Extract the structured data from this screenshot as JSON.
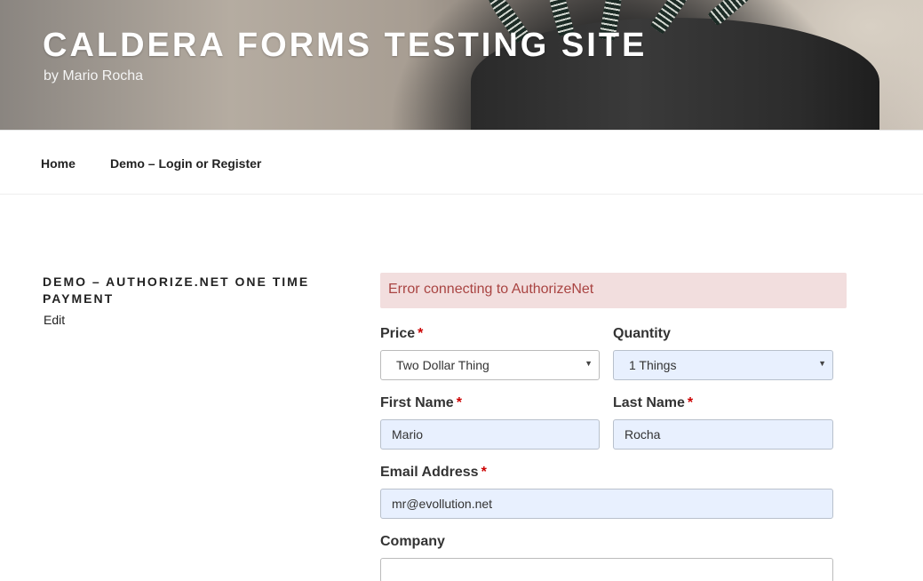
{
  "site": {
    "title": "CALDERA FORMS TESTING SITE",
    "tagline": "by Mario Rocha"
  },
  "nav": {
    "items": [
      {
        "label": "Home"
      },
      {
        "label": "Demo – Login or Register"
      }
    ]
  },
  "page": {
    "title": "DEMO – AUTHORIZE.NET ONE TIME PAYMENT",
    "edit_label": "Edit"
  },
  "form": {
    "error": "Error connecting to AuthorizeNet",
    "required_marker": "*",
    "price": {
      "label": "Price",
      "value": "Two Dollar Thing"
    },
    "quantity": {
      "label": "Quantity",
      "value": "1 Things"
    },
    "first_name": {
      "label": "First Name",
      "value": "Mario"
    },
    "last_name": {
      "label": "Last Name",
      "value": "Rocha"
    },
    "email": {
      "label": "Email Address",
      "value": "mr@evollution.net"
    },
    "company": {
      "label": "Company",
      "value": ""
    }
  },
  "colors": {
    "error_bg": "#f2dede",
    "error_text": "#a94442",
    "required": "#cc0000",
    "autofill_bg": "#e8f0fe"
  },
  "icons": {
    "select_arrow": "triangle-down-icon"
  }
}
